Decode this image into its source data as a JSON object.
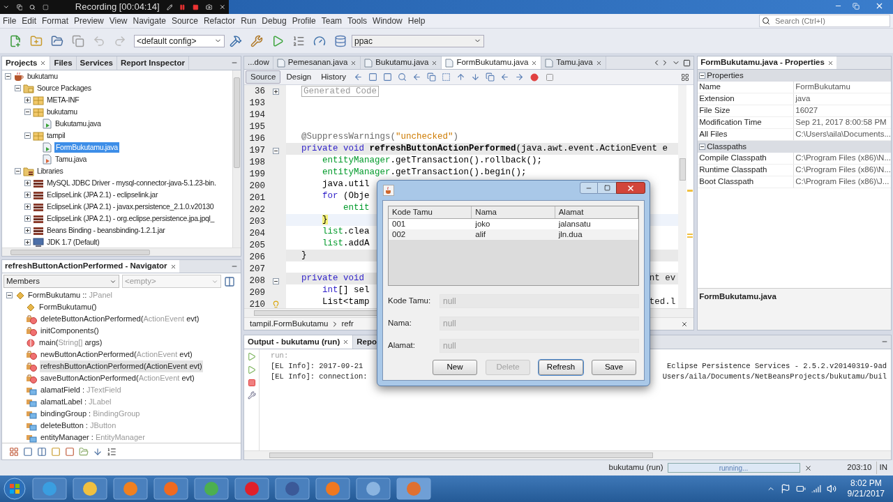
{
  "recorder": {
    "title": "Recording [00:04:14]"
  },
  "menu": [
    "File",
    "Edit",
    "Format",
    "Preview",
    "View",
    "Navigate",
    "Source",
    "Refactor",
    "Run",
    "Debug",
    "Profile",
    "Team",
    "Tools",
    "Window",
    "Help"
  ],
  "search": {
    "placeholder": "Search (Ctrl+I)"
  },
  "toolbar": {
    "config": "<default config>",
    "profile": "ppac"
  },
  "projects": {
    "tabs": [
      {
        "label": "Projects",
        "selected": true
      },
      {
        "label": "Files",
        "selected": false
      },
      {
        "label": "Services",
        "selected": false
      },
      {
        "label": "Report Inspector",
        "selected": false
      }
    ],
    "tree": [
      {
        "label": "bukutamu",
        "kind": "project",
        "expanded": true,
        "selected": false,
        "children": [
          {
            "label": "Source Packages",
            "kind": "sources",
            "expanded": true,
            "selected": false,
            "children": [
              {
                "label": "META-INF",
                "kind": "package",
                "expanded": false,
                "selected": false
              },
              {
                "label": "bukutamu",
                "kind": "package",
                "expanded": true,
                "selected": false,
                "children": [
                  {
                    "label": "Bukutamu.java",
                    "kind": "main",
                    "selected": false
                  }
                ]
              },
              {
                "label": "tampil",
                "kind": "package",
                "expanded": true,
                "selected": false,
                "children": [
                  {
                    "label": "FormBukutamu.java",
                    "kind": "form",
                    "selected": true
                  },
                  {
                    "label": "Tamu.java",
                    "kind": "entity",
                    "selected": false
                  }
                ]
              }
            ]
          },
          {
            "label": "Libraries",
            "kind": "libraries",
            "expanded": true,
            "selected": false,
            "children": [
              {
                "label": "MySQL JDBC Driver - mysql-connector-java-5.1.23-bin.",
                "kind": "jar",
                "expanded": false,
                "selected": false
              },
              {
                "label": "EclipseLink (JPA 2.1) - eclipselink.jar",
                "kind": "jar",
                "expanded": false,
                "selected": false
              },
              {
                "label": "EclipseLink (JPA 2.1) - javax.persistence_2.1.0.v20130",
                "kind": "jar",
                "expanded": false,
                "selected": false
              },
              {
                "label": "EclipseLink (JPA 2.1) - org.eclipse.persistence.jpa.jpql_",
                "kind": "jar",
                "expanded": false,
                "selected": false
              },
              {
                "label": "Beans Binding - beansbinding-1.2.1.jar",
                "kind": "jar",
                "expanded": false,
                "selected": false
              },
              {
                "label": "JDK 1.7 (Default)",
                "kind": "jdk",
                "expanded": false,
                "selected": false
              }
            ]
          }
        ]
      }
    ]
  },
  "navigator": {
    "title": "refreshButtonActionPerformed - Navigator",
    "filter": "Members",
    "secondary": "<empty>",
    "root": {
      "parts": [
        {
          "text": "FormBukutamu :: ",
          "dim": false
        },
        {
          "text": "JPanel",
          "dim": true
        }
      ],
      "expanded": true,
      "selected": false
    },
    "items": [
      {
        "kind": "constructor",
        "selected": false,
        "parts": [
          {
            "text": "FormBukutamu()",
            "dim": false
          }
        ]
      },
      {
        "kind": "method",
        "selected": false,
        "parts": [
          {
            "text": "deleteButtonActionPerformed(",
            "dim": false
          },
          {
            "text": "ActionEvent",
            "dim": true
          },
          {
            "text": " evt)",
            "dim": false
          }
        ]
      },
      {
        "kind": "method",
        "selected": false,
        "parts": [
          {
            "text": "initComponents()",
            "dim": false
          }
        ]
      },
      {
        "kind": "static",
        "selected": false,
        "parts": [
          {
            "text": "main(",
            "dim": false
          },
          {
            "text": "String[]",
            "dim": true
          },
          {
            "text": " args)",
            "dim": false
          }
        ]
      },
      {
        "kind": "method",
        "selected": false,
        "parts": [
          {
            "text": "newButtonActionPerformed(",
            "dim": false
          },
          {
            "text": "ActionEvent",
            "dim": true
          },
          {
            "text": " evt)",
            "dim": false
          }
        ]
      },
      {
        "kind": "method",
        "selected": true,
        "parts": [
          {
            "text": "refreshButtonActionPerformed(ActionEvent evt)",
            "dim": false
          }
        ]
      },
      {
        "kind": "method",
        "selected": false,
        "parts": [
          {
            "text": "saveButtonActionPerformed(",
            "dim": false
          },
          {
            "text": "ActionEvent",
            "dim": true
          },
          {
            "text": " evt)",
            "dim": false
          }
        ]
      },
      {
        "kind": "field",
        "selected": false,
        "parts": [
          {
            "text": "alamatField : ",
            "dim": false
          },
          {
            "text": "JTextField",
            "dim": true
          }
        ]
      },
      {
        "kind": "field",
        "selected": false,
        "parts": [
          {
            "text": "alamatLabel : ",
            "dim": false
          },
          {
            "text": "JLabel",
            "dim": true
          }
        ]
      },
      {
        "kind": "field",
        "selected": false,
        "parts": [
          {
            "text": "bindingGroup : ",
            "dim": false
          },
          {
            "text": "BindingGroup",
            "dim": true
          }
        ]
      },
      {
        "kind": "field",
        "selected": false,
        "parts": [
          {
            "text": "deleteButton : ",
            "dim": false
          },
          {
            "text": "JButton",
            "dim": true
          }
        ]
      },
      {
        "kind": "field",
        "selected": false,
        "parts": [
          {
            "text": "entityManager : ",
            "dim": false
          },
          {
            "text": "EntityManager",
            "dim": true
          }
        ]
      }
    ]
  },
  "editor": {
    "tabs": [
      {
        "label": "...dow",
        "selected": false
      },
      {
        "label": "Pemesanan.java",
        "selected": false
      },
      {
        "label": "Bukutamu.java",
        "selected": false
      },
      {
        "label": "FormBukutamu.java",
        "selected": true
      },
      {
        "label": "Tamu.java",
        "selected": false
      }
    ],
    "views": [
      {
        "label": "Source",
        "selected": true
      },
      {
        "label": "Design",
        "selected": false
      },
      {
        "label": "History",
        "selected": false
      }
    ],
    "lines": [
      {
        "num": "36",
        "collapsed": true,
        "parts": [
          {
            "text": "Generated Code",
            "kind": "folded"
          }
        ]
      },
      {
        "num": "193"
      },
      {
        "num": "194"
      },
      {
        "num": "195"
      },
      {
        "num": "196",
        "parts": [
          {
            "text": "@SuppressWarnings(",
            "kind": "annotation"
          },
          {
            "text": "\"unchecked\"",
            "kind": "string"
          },
          {
            "text": ")",
            "kind": "annotation"
          }
        ]
      },
      {
        "num": "197",
        "collapsed": false,
        "highlight": true,
        "parts": [
          {
            "text": "private void ",
            "kind": "keyword"
          },
          {
            "text": "refreshButtonActionPerformed",
            "kind": "method"
          },
          {
            "text": "(java.awt.event.ActionEvent e",
            "kind": "plain"
          }
        ]
      },
      {
        "num": "198",
        "parts": [
          {
            "text": "    entityManager",
            "kind": "field"
          },
          {
            "text": ".getTransaction().rollback();",
            "kind": "plain"
          }
        ]
      },
      {
        "num": "199",
        "parts": [
          {
            "text": "    entityManager",
            "kind": "field"
          },
          {
            "text": ".getTransaction().begin();",
            "kind": "plain"
          }
        ]
      },
      {
        "num": "200",
        "parts": [
          {
            "text": "    java.util",
            "kind": "plain"
          }
        ]
      },
      {
        "num": "201",
        "parts": [
          {
            "text": "    for",
            "kind": "keyword"
          },
          {
            "text": " (Obje",
            "kind": "plain"
          }
        ]
      },
      {
        "num": "202",
        "parts": [
          {
            "text": "        entit",
            "kind": "field"
          }
        ]
      },
      {
        "num": "203",
        "caret": true,
        "parts": [
          {
            "text": "    }",
            "kind": "match"
          }
        ]
      },
      {
        "num": "204",
        "parts": [
          {
            "text": "    list",
            "kind": "field"
          },
          {
            "text": ".clea",
            "kind": "plain"
          }
        ]
      },
      {
        "num": "205",
        "parts": [
          {
            "text": "    list",
            "kind": "field"
          },
          {
            "text": ".addA",
            "kind": "plain"
          }
        ]
      },
      {
        "num": "206",
        "highlight": true,
        "parts": [
          {
            "text": "}",
            "kind": "plain"
          }
        ]
      },
      {
        "num": "207"
      },
      {
        "num": "208",
        "collapsed": false,
        "highlight": true,
        "parts": [
          {
            "text": "private void",
            "kind": "keyword"
          }
        ],
        "tail": "nt ev"
      },
      {
        "num": "209",
        "parts": [
          {
            "text": "    int",
            "kind": "keyword"
          },
          {
            "text": "[] sel",
            "kind": "plain"
          }
        ]
      },
      {
        "num": "210",
        "hint": true,
        "parts": [
          {
            "text": "    List<tamp",
            "kind": "plain"
          }
        ],
        "tail": "ted.l"
      }
    ],
    "breadcrumbs": [
      "tampil.FormBukutamu",
      "refr"
    ]
  },
  "properties": {
    "title": "FormBukutamu.java - Properties",
    "sections": [
      {
        "title": "Properties",
        "expanded": true,
        "rows": [
          {
            "name": "Name",
            "value": "FormBukutamu"
          },
          {
            "name": "Extension",
            "value": "java"
          },
          {
            "name": "File Size",
            "value": "16027"
          },
          {
            "name": "Modification Time",
            "value": "Sep 21, 2017 8:00:58 PM"
          },
          {
            "name": "All Files",
            "value": "C:\\Users\\aila\\Documents..."
          }
        ]
      },
      {
        "title": "Classpaths",
        "expanded": true,
        "rows": [
          {
            "name": "Compile Classpath",
            "value": "C:\\Program Files (x86)\\N..."
          },
          {
            "name": "Runtime Classpath",
            "value": "C:\\Program Files (x86)\\N..."
          },
          {
            "name": "Boot Classpath",
            "value": "C:\\Program Files (x86)\\J..."
          }
        ]
      }
    ],
    "description": "FormBukutamu.java"
  },
  "output": {
    "tabs": [
      {
        "label": "Output - bukutamu (run)",
        "selected": true
      },
      {
        "label": "Repo",
        "selected": false
      }
    ],
    "lines": [
      {
        "text": "run:",
        "dim": true
      },
      {
        "text": "[EL Info]: 2017-09-21 ",
        "dim": false,
        "tail": "Eclipse Persistence Services - 2.5.2.v20140319-9ad"
      },
      {
        "text": "[EL Info]: connection:",
        "dim": false,
        "tail": "Users/aila/Documents/NetBeansProjects/bukutamu/buil"
      }
    ]
  },
  "dialog": {
    "columns": [
      "Kode Tamu",
      "Nama",
      "Alamat"
    ],
    "rows": [
      [
        "001",
        "joko",
        "jalansatu"
      ],
      [
        "002",
        "alif",
        "jln.dua"
      ]
    ],
    "fields": [
      {
        "label": "Kode Tamu:",
        "value": "null",
        "disabled": true
      },
      {
        "label": "Nama:",
        "value": "null",
        "disabled": true
      },
      {
        "label": "Alamat:",
        "value": "null",
        "disabled": true
      }
    ],
    "buttons": [
      {
        "label": "New",
        "disabled": false,
        "focused": false
      },
      {
        "label": "Delete",
        "disabled": true,
        "focused": false
      },
      {
        "label": "Refresh",
        "disabled": false,
        "focused": true
      },
      {
        "label": "Save",
        "disabled": false,
        "focused": false
      }
    ]
  },
  "status": {
    "task": "bukutamu (run)",
    "progress": {
      "text": "running...",
      "level": 1
    },
    "position": "203:10",
    "mode": "IN"
  },
  "clock": {
    "time": "8:02 PM",
    "date": "9/21/2017"
  }
}
